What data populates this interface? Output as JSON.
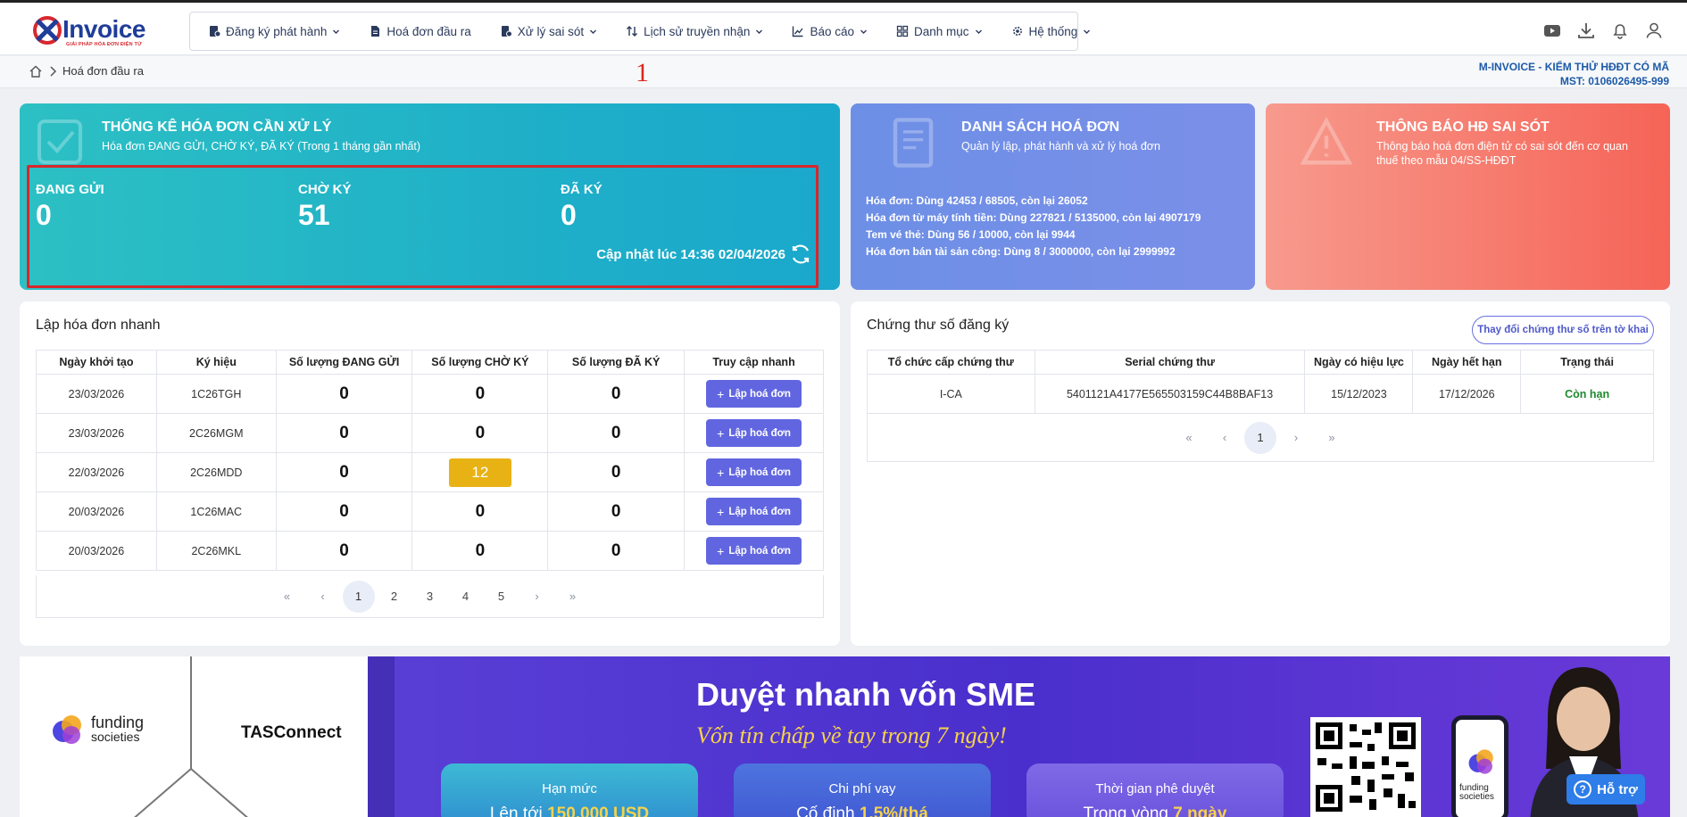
{
  "app": {
    "logo_text": "Invoice",
    "logo_tagline": "GIẢI PHÁP HÓA ĐƠN ĐIỆN TỬ"
  },
  "nav": [
    {
      "label": "Đăng ký phát hành",
      "icon": "register-icon",
      "has_dropdown": true
    },
    {
      "label": "Hoá đơn đầu ra",
      "icon": "document-icon",
      "has_dropdown": false
    },
    {
      "label": "Xử lý sai sót",
      "icon": "error-handling-icon",
      "has_dropdown": true
    },
    {
      "label": "Lịch sử truyền nhận",
      "icon": "transfer-icon",
      "has_dropdown": true
    },
    {
      "label": "Báo cáo",
      "icon": "chart-icon",
      "has_dropdown": true
    },
    {
      "label": "Danh mục",
      "icon": "grid-icon",
      "has_dropdown": true
    },
    {
      "label": "Hệ thống",
      "icon": "gear-icon",
      "has_dropdown": true
    }
  ],
  "top_icons": [
    "youtube-icon",
    "download-icon",
    "bell-icon",
    "user-icon"
  ],
  "breadcrumb": {
    "page": "Hoá đơn đầu ra",
    "marker": "1"
  },
  "company": {
    "name": "M-INVOICE - KIỂM THỬ HĐĐT CÓ MÃ",
    "tax_code": "MST: 0106026495-999"
  },
  "stats_card": {
    "title": "THỐNG KÊ HÓA ĐƠN CẦN XỬ LÝ",
    "subtitle": "Hóa đơn ĐANG GỬI, CHỜ KÝ, ĐÃ KÝ (Trong 1 tháng gần nhất)",
    "items": [
      {
        "label": "ĐANG GỬI",
        "value": "0"
      },
      {
        "label": "CHỜ KÝ",
        "value": "51"
      },
      {
        "label": "ĐÃ KÝ",
        "value": "0"
      }
    ],
    "updated": "Cập nhật lúc 14:36 02/04/2026"
  },
  "invoice_list_card": {
    "title": "DANH SÁCH HOÁ ĐƠN",
    "subtitle": "Quản lý lập, phát hành và xử lý hoá đơn",
    "usage": [
      "Hóa đơn: Dùng 42453 / 68505, còn lại 26052",
      "Hóa đơn từ máy tính tiền: Dùng 227821 / 5135000, còn lại 4907179",
      "Tem vé thẻ: Dùng 56 / 10000, còn lại 9944",
      "Hóa đơn bán tài sản công: Dùng 8 / 3000000, còn lại 2999992"
    ]
  },
  "error_card": {
    "title": "THÔNG BÁO HĐ SAI SÓT",
    "subtitle": "Thông báo hoá đơn điện tử có sai sót đến cơ quan thuế theo mẫu 04/SS-HĐĐT"
  },
  "quick_invoice": {
    "title": "Lập hóa đơn nhanh",
    "columns": [
      "Ngày khởi tạo",
      "Ký hiệu",
      "Số lượng ĐANG GỬI",
      "Số lượng CHỜ KÝ",
      "Số lượng ĐÃ KÝ",
      "Truy cập nhanh"
    ],
    "rows": [
      {
        "date": "23/03/2026",
        "symbol": "1C26TGH",
        "sending": "0",
        "pending": "0",
        "signed": "0",
        "highlight": false
      },
      {
        "date": "23/03/2026",
        "symbol": "2C26MGM",
        "sending": "0",
        "pending": "0",
        "signed": "0",
        "highlight": false
      },
      {
        "date": "22/03/2026",
        "symbol": "2C26MDD",
        "sending": "0",
        "pending": "12",
        "signed": "0",
        "highlight": true
      },
      {
        "date": "20/03/2026",
        "symbol": "1C26MAC",
        "sending": "0",
        "pending": "0",
        "signed": "0",
        "highlight": false
      },
      {
        "date": "20/03/2026",
        "symbol": "2C26MKL",
        "sending": "0",
        "pending": "0",
        "signed": "0",
        "highlight": false
      }
    ],
    "action_label": "Lập hoá đơn",
    "pages": [
      "1",
      "2",
      "3",
      "4",
      "5"
    ],
    "active_page": "1"
  },
  "certificates": {
    "title": "Chứng thư số đăng ký",
    "change_button": "Thay đổi chứng thư số trên tờ khai",
    "columns": [
      "Tổ chức cấp chứng thư",
      "Serial chứng thư",
      "Ngày có hiệu lực",
      "Ngày hết hạn",
      "Trạng thái"
    ],
    "rows": [
      {
        "issuer": "I-CA",
        "serial": "5401121A4177E565503159C44B8BAF13",
        "valid_from": "15/12/2023",
        "valid_to": "17/12/2026",
        "status": "Còn hạn"
      }
    ],
    "pages": [
      "1"
    ]
  },
  "banner": {
    "partner1_line1": "funding",
    "partner1_line2": "societies",
    "partner2": "TASConnect",
    "headline": "Duyệt nhanh vốn SME",
    "tagline": "Vốn tín chấp về tay trong 7 ngày!",
    "cards": [
      {
        "label": "Hạn mức",
        "value_prefix": "Lên tới ",
        "value_highlight": "150.000 USD"
      },
      {
        "label": "Chi phí vay",
        "value_prefix": "Cố định ",
        "value_highlight": "1,5%/thá"
      },
      {
        "label": "Thời gian phê duyệt",
        "value_prefix": "Trong vòng ",
        "value_highlight": "7 ngày"
      }
    ],
    "phone_line1": "funding",
    "phone_line2": "societies"
  },
  "help_button": "Hỗ trợ"
}
